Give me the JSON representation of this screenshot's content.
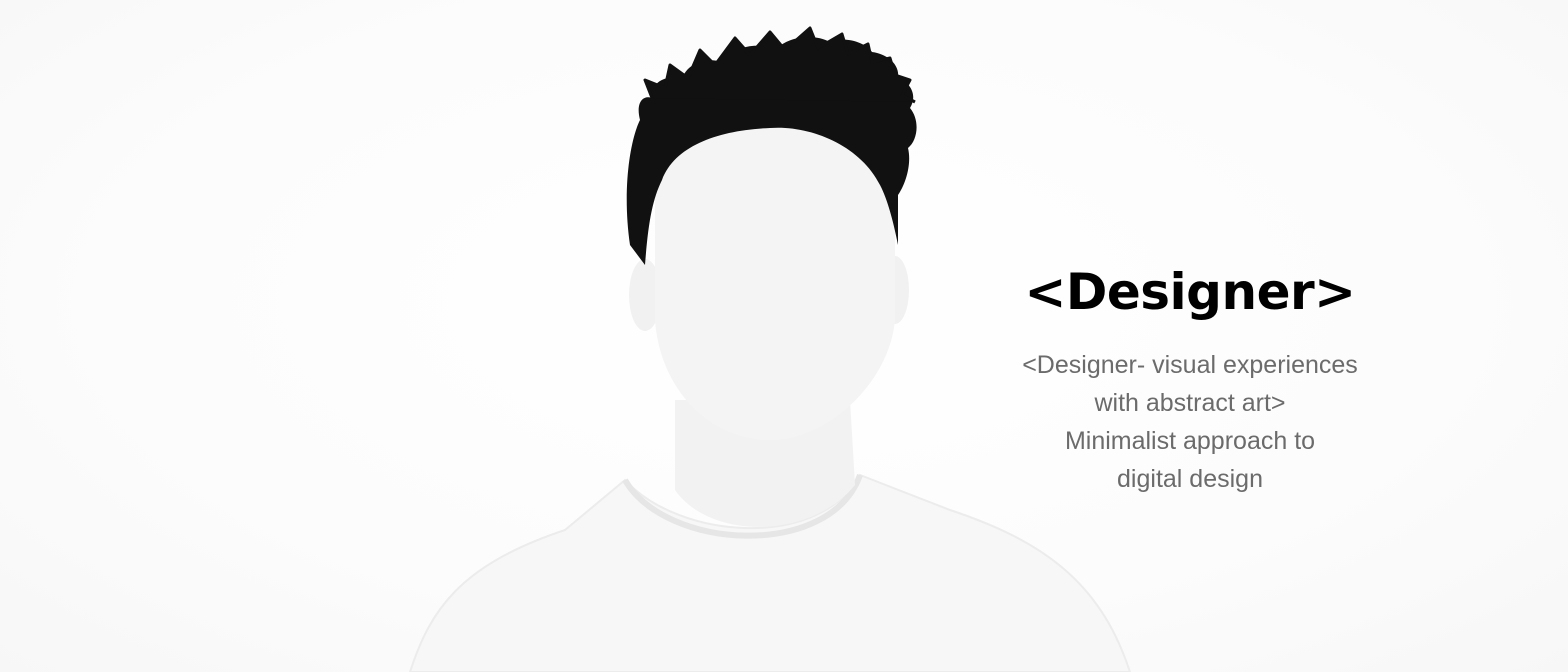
{
  "hero": {
    "heading": "<Designer>",
    "subtitle_lines": [
      "<Designer- visual experiences",
      "with abstract art>",
      "Minimalist approach to",
      "digital design"
    ]
  },
  "portrait": {
    "hair_color": "#111111",
    "skin_color": "#f4f4f4",
    "shirt_color": "#f7f7f7",
    "shirt_shadow": "#e9e9e9"
  }
}
